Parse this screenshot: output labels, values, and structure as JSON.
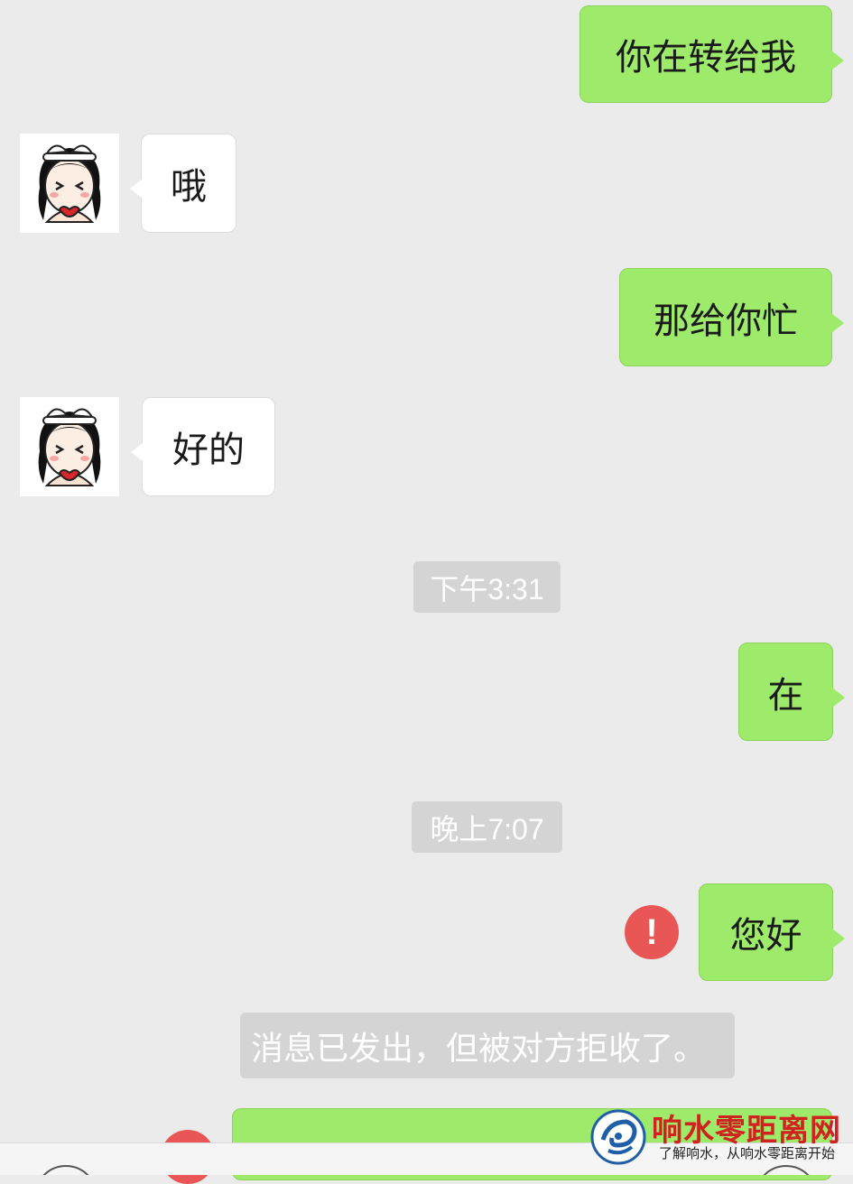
{
  "conversation": {
    "messages": [
      {
        "side": "out",
        "text": "你在转给我"
      },
      {
        "side": "in",
        "text": "哦"
      },
      {
        "side": "out",
        "text": "那给你忙"
      },
      {
        "side": "in",
        "text": "好的"
      },
      {
        "side": "out",
        "text": "在"
      },
      {
        "side": "out",
        "text": "您好",
        "status": "failed"
      }
    ],
    "timestamps": [
      "下午3:31",
      "晚上7:07"
    ],
    "system_notice": "消息已发出，但被对方拒收了。",
    "error_symbol": "!"
  },
  "watermark": {
    "title": "响水零距离网",
    "subtitle": "了解响水，从响水零距离开始"
  },
  "icons": {
    "avatar": "cartoon-girl-avatar-icon",
    "error": "exclamation-circle-icon",
    "watermark_logo": "swirl-logo-icon"
  },
  "colors": {
    "background": "#ebebeb",
    "outgoing_bubble": "#9eea6a",
    "incoming_bubble": "#ffffff",
    "timestamp_bg": "#d4d4d4",
    "error_red": "#e95656",
    "watermark_red": "#d0231f",
    "watermark_blue": "#1f5fa8"
  }
}
